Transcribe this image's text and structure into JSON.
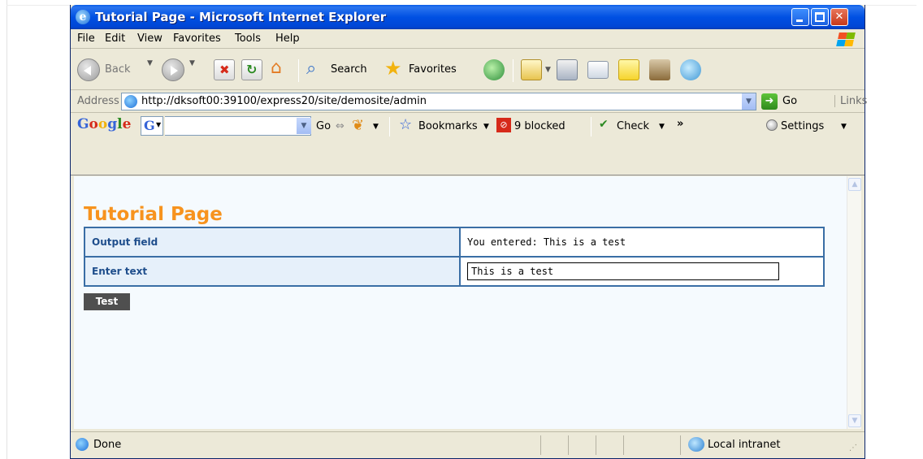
{
  "window": {
    "title": "Tutorial Page - Microsoft Internet Explorer"
  },
  "menu": {
    "file": "File",
    "edit": "Edit",
    "view": "View",
    "favorites": "Favorites",
    "tools": "Tools",
    "help": "Help"
  },
  "toolbar": {
    "back": "Back",
    "search": "Search",
    "favorites": "Favorites"
  },
  "address": {
    "label": "Address",
    "url": "http://dksoft00:39100/express20/site/demosite/admin",
    "go": "Go",
    "links": "Links"
  },
  "google_bar": {
    "logo": "Google",
    "go": "Go",
    "bookmarks": "Bookmarks",
    "blocked": "9 blocked",
    "check": "Check",
    "more": "»",
    "settings": "Settings"
  },
  "page": {
    "title": "Tutorial Page",
    "rows": [
      {
        "label": "Output field",
        "value": "You entered: This is a test"
      },
      {
        "label": "Enter text",
        "value": "This is a test"
      }
    ],
    "button": "Test"
  },
  "status": {
    "text": "Done",
    "zone": "Local intranet"
  },
  "colors": {
    "title_orange": "#f7931e",
    "table_border": "#3a6ea5",
    "label_blue": "#1f4e8c",
    "titlebar_blue": "#0050e3"
  }
}
